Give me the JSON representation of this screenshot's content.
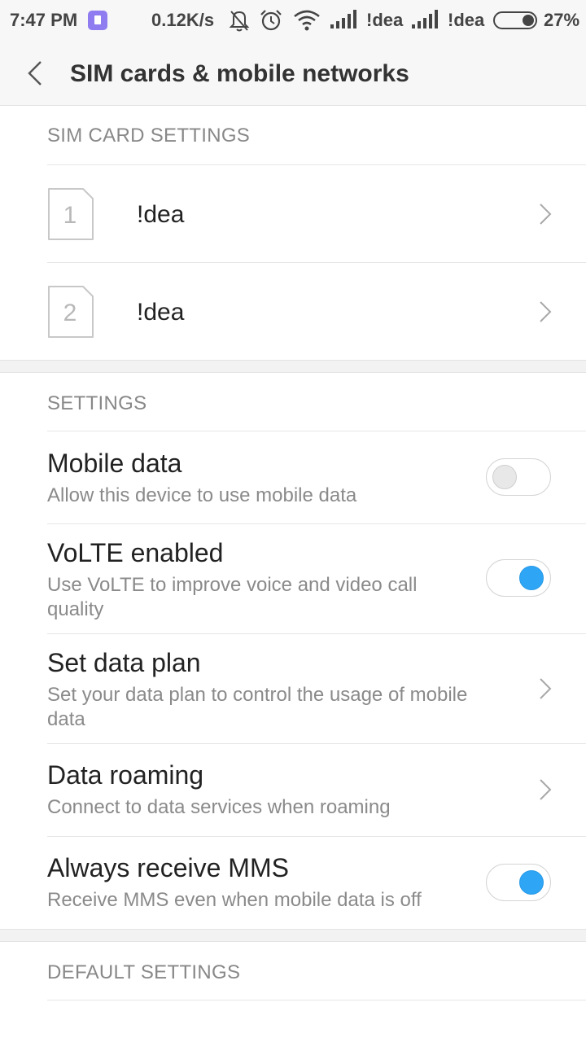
{
  "status_bar": {
    "time": "7:47 PM",
    "net_speed": "0.12K/s",
    "carrier_1": "!dea",
    "carrier_2": "!dea",
    "battery_pct": "27%"
  },
  "toolbar": {
    "title": "SIM cards & mobile networks"
  },
  "sim_section": {
    "header": "SIM CARD SETTINGS",
    "items": [
      {
        "number": "1",
        "label": "!dea"
      },
      {
        "number": "2",
        "label": "!dea"
      }
    ]
  },
  "settings_section": {
    "header": "SETTINGS",
    "items": [
      {
        "title": "Mobile data",
        "subtitle": "Allow this device to use mobile data",
        "control": "toggle",
        "enabled": false
      },
      {
        "title": "VoLTE enabled",
        "subtitle": "Use VoLTE to improve voice and video call quality",
        "control": "toggle",
        "enabled": true
      },
      {
        "title": "Set data plan",
        "subtitle": "Set your data plan to control the usage of mobile data",
        "control": "chevron"
      },
      {
        "title": "Data roaming",
        "subtitle": "Connect to data services when roaming",
        "control": "chevron"
      },
      {
        "title": "Always receive MMS",
        "subtitle": "Receive MMS even when mobile data is off",
        "control": "toggle",
        "enabled": true
      }
    ]
  },
  "default_section": {
    "header": "DEFAULT SETTINGS"
  },
  "colors": {
    "accent": "#2ea5f5",
    "header_text": "#888888",
    "background": "#ffffff",
    "toolbar": "#f7f7f7"
  }
}
